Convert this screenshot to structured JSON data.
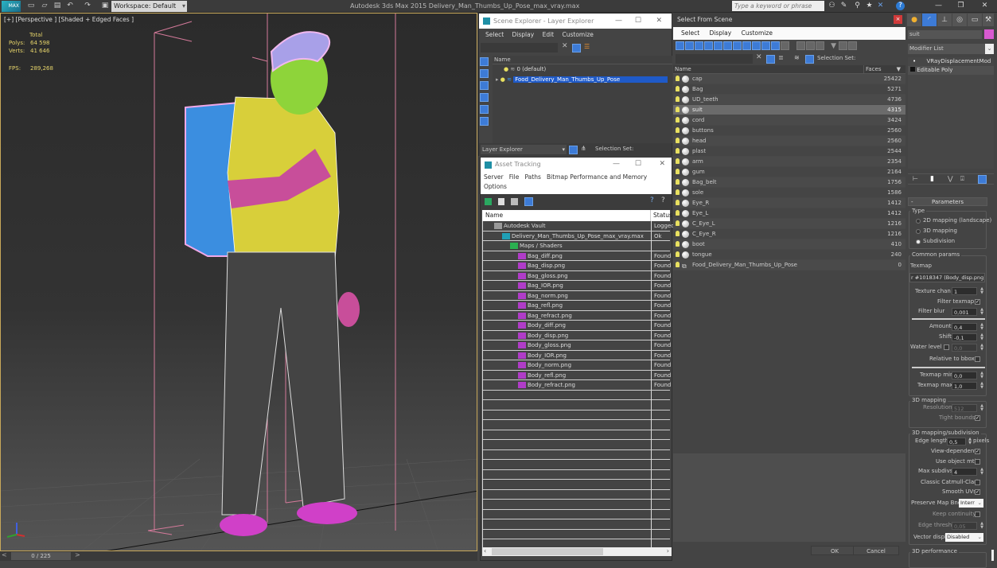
{
  "topbar": {
    "logo": "MAX",
    "workspace": "Workspace: Default",
    "app_title": "Autodesk 3ds Max  2015     Delivery_Man_Thumbs_Up_Pose_max_vray.max",
    "search_placeholder": "Type a keyword or phrase"
  },
  "viewport": {
    "label": "[+] [Perspective ] [Shaded + Edged Faces ]",
    "stats": {
      "total_label": "Total",
      "polys_label": "Polys:",
      "polys_value": "64 598",
      "verts_label": "Verts:",
      "verts_value": "41 646",
      "fps_label": "FPS:",
      "fps_value": "289,268"
    },
    "timeline": {
      "frame": "0 / 225",
      "prev": "<",
      "next": ">"
    }
  },
  "layer_explorer": {
    "title": "Scene Explorer - Layer Explorer",
    "menu": [
      "Select",
      "Display",
      "Edit",
      "Customize"
    ],
    "column_name": "Name",
    "layers": [
      {
        "name": "0 (default)",
        "selected": false
      },
      {
        "name": "Food_Delivery_Man_Thumbs_Up_Pose",
        "selected": true
      }
    ],
    "footer_dropdown": "Layer Explorer",
    "selection_set_label": "Selection Set:"
  },
  "asset_tracking": {
    "title": "Asset Tracking",
    "menu": [
      "Server",
      "File",
      "Paths",
      "Bitmap Performance and Memory",
      "Options"
    ],
    "columns": {
      "name": "Name",
      "status": "Status"
    },
    "rows": [
      {
        "name": "Autodesk Vault",
        "status": "Logged",
        "indent": 1,
        "icon": "vault-icon"
      },
      {
        "name": "Delivery_Man_Thumbs_Up_Pose_max_vray.max",
        "status": "Ok",
        "indent": 2,
        "icon": "max-file-icon"
      },
      {
        "name": "Maps / Shaders",
        "status": "",
        "indent": 3,
        "icon": "maps-folder-icon"
      },
      {
        "name": "Bag_diff.png",
        "status": "Found",
        "indent": 4,
        "icon": "png-icon"
      },
      {
        "name": "Bag_disp.png",
        "status": "Found",
        "indent": 4,
        "icon": "png-icon"
      },
      {
        "name": "Bag_gloss.png",
        "status": "Found",
        "indent": 4,
        "icon": "png-icon"
      },
      {
        "name": "Bag_IOR.png",
        "status": "Found",
        "indent": 4,
        "icon": "png-icon"
      },
      {
        "name": "Bag_norm.png",
        "status": "Found",
        "indent": 4,
        "icon": "png-icon"
      },
      {
        "name": "Bag_refl.png",
        "status": "Found",
        "indent": 4,
        "icon": "png-icon"
      },
      {
        "name": "Bag_refract.png",
        "status": "Found",
        "indent": 4,
        "icon": "png-icon"
      },
      {
        "name": "Body_diff.png",
        "status": "Found",
        "indent": 4,
        "icon": "png-icon"
      },
      {
        "name": "Body_disp.png",
        "status": "Found",
        "indent": 4,
        "icon": "png-icon"
      },
      {
        "name": "Body_gloss.png",
        "status": "Found",
        "indent": 4,
        "icon": "png-icon"
      },
      {
        "name": "Body_IOR.png",
        "status": "Found",
        "indent": 4,
        "icon": "png-icon"
      },
      {
        "name": "Body_norm.png",
        "status": "Found",
        "indent": 4,
        "icon": "png-icon"
      },
      {
        "name": "Body_refl.png",
        "status": "Found",
        "indent": 4,
        "icon": "png-icon"
      },
      {
        "name": "Body_refract.png",
        "status": "Found",
        "indent": 4,
        "icon": "png-icon"
      }
    ],
    "empty_rows": 16
  },
  "select_from_scene": {
    "title": "Select From Scene",
    "menu": [
      "Select",
      "Display",
      "Customize"
    ],
    "selection_set_label": "Selection Set:",
    "columns": {
      "name": "Name",
      "faces": "Faces"
    },
    "objects": [
      {
        "name": "cap",
        "faces": "25422",
        "selected": false
      },
      {
        "name": "Bag",
        "faces": "5271",
        "selected": false
      },
      {
        "name": "UD_teeth",
        "faces": "4736",
        "selected": false
      },
      {
        "name": "suit",
        "faces": "4315",
        "selected": true
      },
      {
        "name": "cord",
        "faces": "3424",
        "selected": false
      },
      {
        "name": "buttons",
        "faces": "2560",
        "selected": false
      },
      {
        "name": "head",
        "faces": "2560",
        "selected": false
      },
      {
        "name": "plast",
        "faces": "2544",
        "selected": false
      },
      {
        "name": "arm",
        "faces": "2354",
        "selected": false
      },
      {
        "name": "gum",
        "faces": "2164",
        "selected": false
      },
      {
        "name": "Bag_belt",
        "faces": "1756",
        "selected": false
      },
      {
        "name": "sole",
        "faces": "1586",
        "selected": false
      },
      {
        "name": "Eye_R",
        "faces": "1412",
        "selected": false
      },
      {
        "name": "Eye_L",
        "faces": "1412",
        "selected": false
      },
      {
        "name": "C_Eye_L",
        "faces": "1216",
        "selected": false
      },
      {
        "name": "C_Eye_R",
        "faces": "1216",
        "selected": false
      },
      {
        "name": "boot",
        "faces": "410",
        "selected": false
      },
      {
        "name": "tongue",
        "faces": "240",
        "selected": false
      },
      {
        "name": "Food_Delivery_Man_Thumbs_Up_Pose",
        "faces": "0",
        "selected": false,
        "group": true
      }
    ],
    "ok_label": "OK",
    "cancel_label": "Cancel"
  },
  "command_panel": {
    "object_name": "suit",
    "object_color": "#d85ad0",
    "modifier_list": "Modifier List",
    "stack": [
      "VRayDisplacementMod",
      "Editable Poly"
    ],
    "rollout": "Parameters",
    "type_group": "Type",
    "type_options": [
      {
        "label": "2D mapping (landscape)",
        "checked": false
      },
      {
        "label": "3D mapping",
        "checked": false
      },
      {
        "label": "Subdivision",
        "checked": true
      }
    ],
    "common_group": "Common params",
    "texmap_label": "Texmap",
    "texmap_value": "r #1018347 (Body_disp.png)",
    "texture_chan_label": "Texture chan",
    "texture_chan": "1",
    "filter_texmap_label": "Filter texmap",
    "filter_texmap": true,
    "filter_blur_label": "Filter blur",
    "filter_blur": "0,001",
    "amount_label": "Amount",
    "amount": "0,4",
    "shift_label": "Shift",
    "shift": "-0,1",
    "water_level_label": "Water level",
    "water_level": "0,0",
    "relative_bbox_label": "Relative to bbox",
    "texmap_min_label": "Texmap min",
    "texmap_min": "0,0",
    "texmap_max_label": "Texmap max",
    "texmap_max": "1,0",
    "mapping3d_group": "3D mapping",
    "resolution_label": "Resolution",
    "resolution": "512",
    "tight_bounds_label": "Tight bounds",
    "subdiv_group": "3D mapping/subdivision",
    "edge_length_label": "Edge length",
    "edge_length": "0,5",
    "pixels_label": "pixels",
    "view_dependent_label": "View-dependent",
    "use_object_mtl_label": "Use object mtl",
    "max_subdivs_label": "Max subdivs",
    "max_subdivs": "4",
    "classic_cc_label": "Classic Catmull-Clark",
    "smooth_uvs_label": "Smooth UVs",
    "preserve_map_label": "Preserve Map Bnd",
    "preserve_map": "Interr",
    "keep_continuity_label": "Keep continuity",
    "edge_thresh_label": "Edge thresh",
    "edge_thresh": "0,05",
    "vector_displ_label": "Vector displ",
    "vector_displ": "Disabled",
    "perf_group": "3D performance"
  }
}
